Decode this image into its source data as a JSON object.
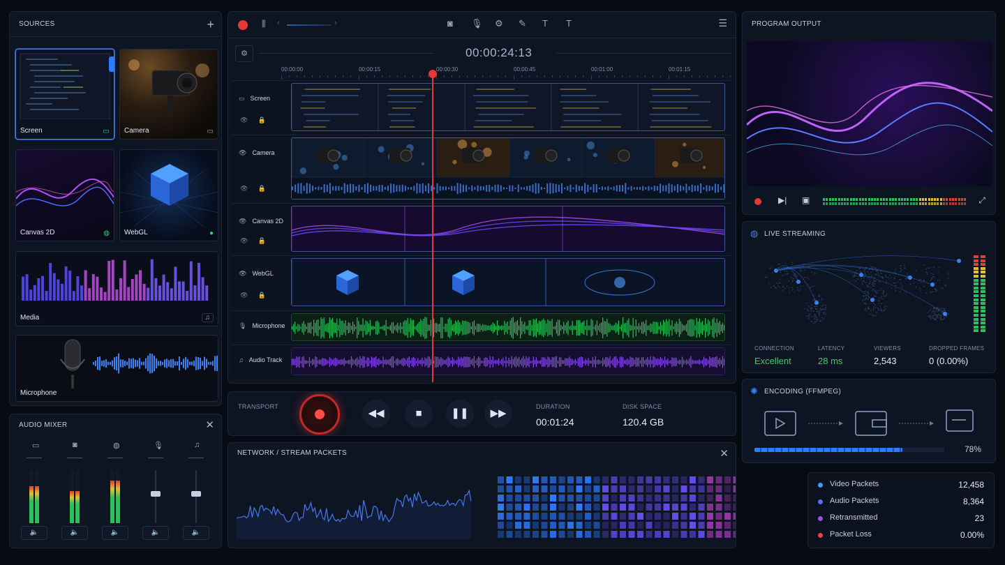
{
  "sources": {
    "title": "SOURCES",
    "add_icon": "plus-icon",
    "items": [
      {
        "label": "Screen",
        "icon": "monitor-icon"
      },
      {
        "label": "Camera",
        "icon": "monitor-icon"
      },
      {
        "label": "Canvas 2D",
        "icon": "globe-icon"
      },
      {
        "label": "WebGL",
        "icon": "status-dot-icon"
      },
      {
        "label": "Media",
        "icon": "music-note-icon"
      },
      {
        "label": "Microphone",
        "icon": ""
      }
    ]
  },
  "mixer": {
    "title": "AUDIO MIXER",
    "channels": [
      {
        "icon": "monitor-icon",
        "level": 0.7
      },
      {
        "icon": "camera-icon",
        "level": 0.6
      },
      {
        "icon": "globe-icon",
        "level": 0.8
      },
      {
        "icon": "microphone-icon",
        "level": 0.55
      },
      {
        "icon": "music-note-icon",
        "level": 0.55
      }
    ]
  },
  "toolbar": {
    "icons": [
      "camera-icon",
      "microphone-icon",
      "gear-icon",
      "pen-icon",
      "text-icon",
      "text-icon"
    ]
  },
  "timeline": {
    "timecode": "00:00:24:13",
    "ruler": [
      "00:00:00",
      "00:00:15",
      "00:00:30",
      "00:00:45",
      "00:01:00",
      "00:01:15"
    ],
    "tracks": [
      {
        "name": "Screen"
      },
      {
        "name": "Camera"
      },
      {
        "name": "Canvas 2D"
      },
      {
        "name": "WebGL"
      },
      {
        "name": "Microphone"
      },
      {
        "name": "Audio Track"
      }
    ]
  },
  "transport": {
    "label": "TRANSPORT",
    "duration_label": "DURATION",
    "duration": "00:01:24",
    "disk_label": "DISK SPACE",
    "disk": "120.4 GB"
  },
  "network": {
    "title": "NETWORK / STREAM PACKETS",
    "stats": [
      {
        "label": "Video Packets",
        "value": "12,458",
        "color": "#3b9cf0"
      },
      {
        "label": "Audio Packets",
        "value": "8,364",
        "color": "#5a6cf0"
      },
      {
        "label": "Retransmitted",
        "value": "23",
        "color": "#a050e0"
      },
      {
        "label": "Packet Loss",
        "value": "0.00%",
        "color": "#e04848"
      }
    ]
  },
  "program": {
    "title": "PROGRAM OUTPUT"
  },
  "live": {
    "title": "LIVE STREAMING",
    "stats": [
      {
        "label": "CONNECTION",
        "value": "Excellent",
        "color": "#3ad06a"
      },
      {
        "label": "LATENCY",
        "value": "28 ms",
        "color": "#3ad06a"
      },
      {
        "label": "VIEWERS",
        "value": "2,543",
        "color": "#e6ecf6"
      },
      {
        "label": "DROPPED FRAMES",
        "value": "0 (0.00%)",
        "color": "#e6ecf6"
      }
    ]
  },
  "encoding": {
    "title": "ENCODING (FFMPEG)",
    "progress": 0.78,
    "percent": "78%"
  },
  "colors": {
    "accent": "#3b82f6",
    "record": "#e53935",
    "green": "#3ad06a",
    "purple": "#9b4dff"
  }
}
